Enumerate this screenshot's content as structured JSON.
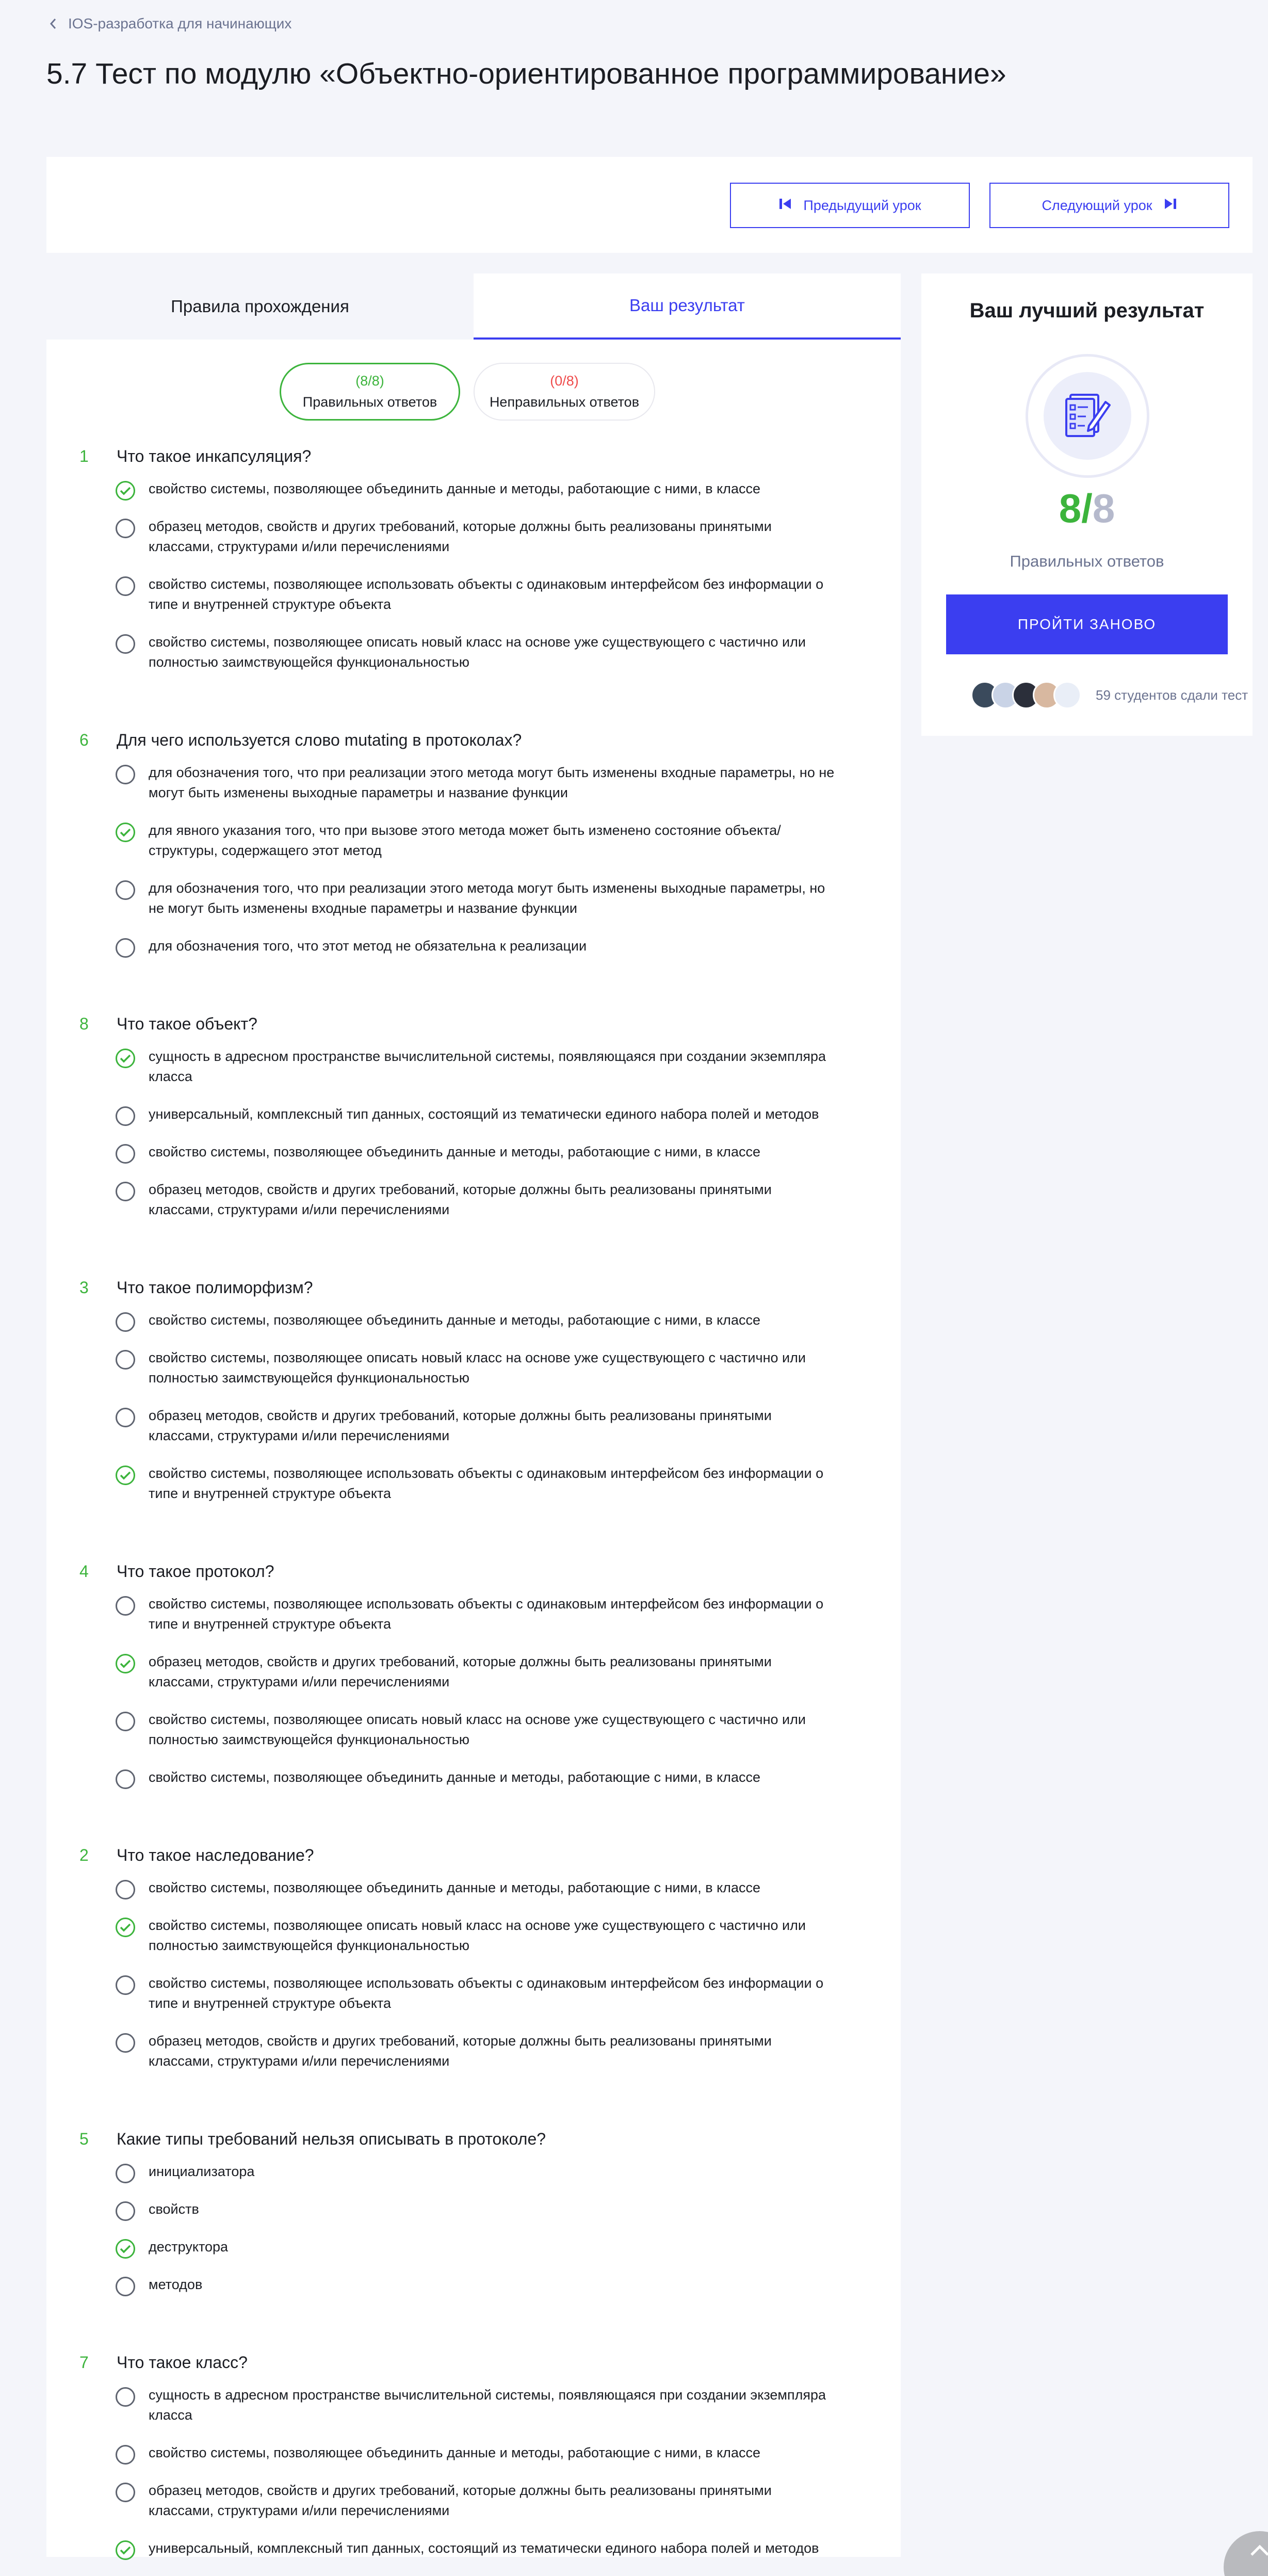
{
  "breadcrumb": {
    "label": "IOS-разработка для начинающих"
  },
  "page": {
    "title": "5.7 Тест по модулю «Объектно-ориентированное программирование»"
  },
  "nav": {
    "prev_label": "Предыдущий урок",
    "next_label": "Следующий урок"
  },
  "tabs": {
    "rules": "Правила прохождения",
    "result": "Ваш результат",
    "active": "result"
  },
  "summary": {
    "correct_count": "(8/8)",
    "correct_label": "Правильных ответов",
    "wrong_count": "(0/8)",
    "wrong_label": "Неправильных ответов"
  },
  "questions": [
    {
      "number": "1",
      "text": "Что такое инкапсуляция?",
      "options": [
        {
          "lines": [
            "свойство системы, позволяющее объединить данные и методы, работающие с ними, в классе"
          ],
          "selected": true
        },
        {
          "lines": [
            "образец методов, свойств и других требований, которые должны быть реализованы принятыми",
            "классами, структурами и/или перечислениями"
          ],
          "selected": false
        },
        {
          "lines": [
            "свойство системы, позволяющее использовать объекты с одинаковым интерфейсом без информации о",
            "типе и внутренней структуре объекта"
          ],
          "selected": false
        },
        {
          "lines": [
            "свойство системы, позволяющее описать новый класс на основе уже существующего с частично или",
            "полностью заимствующейся функциональностью"
          ],
          "selected": false
        }
      ]
    },
    {
      "number": "6",
      "text": "Для чего используется слово mutating в протоколах?",
      "options": [
        {
          "lines": [
            "для обозначения того, что при реализации этого метода могут быть изменены входные параметры, но не",
            "могут быть изменены выходные параметры и название функции"
          ],
          "selected": false
        },
        {
          "lines": [
            "для явного указания того, что при вызове этого метода может быть изменено состояние объекта/",
            "структуры, содержащего этот метод"
          ],
          "selected": true
        },
        {
          "lines": [
            "для обозначения того, что при реализации этого метода могут быть изменены выходные параметры, но",
            "не могут быть изменены входные параметры и название функции"
          ],
          "selected": false
        },
        {
          "lines": [
            "для обозначения того, что этот метод не обязательна к реализации"
          ],
          "selected": false
        }
      ]
    },
    {
      "number": "8",
      "text": "Что такое объект?",
      "options": [
        {
          "lines": [
            "сущность в адресном пространстве вычислительной системы, появляющаяся при создании экземпляра",
            "класса"
          ],
          "selected": true
        },
        {
          "lines": [
            "универсальный, комплексный тип данных, состоящий из тематически единого набора полей и методов"
          ],
          "selected": false
        },
        {
          "lines": [
            "свойство системы, позволяющее объединить данные и методы, работающие с ними, в классе"
          ],
          "selected": false
        },
        {
          "lines": [
            "образец методов, свойств и других требований, которые должны быть реализованы принятыми",
            "классами, структурами и/или перечислениями"
          ],
          "selected": false
        }
      ]
    },
    {
      "number": "3",
      "text": "Что такое полиморфизм?",
      "options": [
        {
          "lines": [
            "свойство системы, позволяющее объединить данные и методы, работающие с ними, в классе"
          ],
          "selected": false
        },
        {
          "lines": [
            "свойство системы, позволяющее описать новый класс на основе уже существующего с частично или",
            "полностью заимствующейся функциональностью"
          ],
          "selected": false
        },
        {
          "lines": [
            "образец методов, свойств и других требований, которые должны быть реализованы принятыми",
            "классами, структурами и/или перечислениями"
          ],
          "selected": false
        },
        {
          "lines": [
            "свойство системы, позволяющее использовать объекты с одинаковым интерфейсом без информации о",
            "типе и внутренней структуре объекта"
          ],
          "selected": true
        }
      ]
    },
    {
      "number": "4",
      "text": "Что такое протокол?",
      "options": [
        {
          "lines": [
            "свойство системы, позволяющее использовать объекты с одинаковым интерфейсом без информации о",
            "типе и внутренней структуре объекта"
          ],
          "selected": false
        },
        {
          "lines": [
            "образец методов, свойств и других требований, которые должны быть реализованы принятыми",
            "классами, структурами и/или перечислениями"
          ],
          "selected": true
        },
        {
          "lines": [
            "свойство системы, позволяющее описать новый класс на основе уже существующего с частично или",
            "полностью заимствующейся функциональностью"
          ],
          "selected": false
        },
        {
          "lines": [
            "свойство системы, позволяющее объединить данные и методы, работающие с ними, в классе"
          ],
          "selected": false
        }
      ]
    },
    {
      "number": "2",
      "text": "Что такое наследование?",
      "options": [
        {
          "lines": [
            "свойство системы, позволяющее объединить данные и методы, работающие с ними, в классе"
          ],
          "selected": false
        },
        {
          "lines": [
            "свойство системы, позволяющее описать новый класс на основе уже существующего с частично или",
            "полностью заимствующейся функциональностью"
          ],
          "selected": true
        },
        {
          "lines": [
            "свойство системы, позволяющее использовать объекты с одинаковым интерфейсом без информации о",
            "типе и внутренней структуре объекта"
          ],
          "selected": false
        },
        {
          "lines": [
            "образец методов, свойств и других требований, которые должны быть реализованы принятыми",
            "классами, структурами и/или перечислениями"
          ],
          "selected": false
        }
      ]
    },
    {
      "number": "5",
      "text": "Какие типы требований нельзя описывать в протоколе?",
      "options": [
        {
          "lines": [
            "инициализатора"
          ],
          "selected": false
        },
        {
          "lines": [
            "свойств"
          ],
          "selected": false
        },
        {
          "lines": [
            "деструктора"
          ],
          "selected": true
        },
        {
          "lines": [
            "методов"
          ],
          "selected": false
        }
      ]
    },
    {
      "number": "7",
      "text": "Что такое класс?",
      "options": [
        {
          "lines": [
            "сущность в адресном пространстве вычислительной системы, появляющаяся при создании экземпляра",
            "класса"
          ],
          "selected": false
        },
        {
          "lines": [
            "свойство системы, позволяющее объединить данные и методы, работающие с ними, в классе"
          ],
          "selected": false
        },
        {
          "lines": [
            "образец методов, свойств и других требований, которые должны быть реализованы принятыми",
            "классами, структурами и/или перечислениями"
          ],
          "selected": false
        },
        {
          "lines": [
            "универсальный, комплексный тип данных, состоящий из тематически единого набора полей и методов"
          ],
          "selected": true
        }
      ]
    }
  ],
  "best_result": {
    "title": "Ваш лучший результат",
    "score_correct": "8",
    "score_separator": "/",
    "score_total": "8",
    "label": "Правильных ответов",
    "retry_label": "ПРОЙТИ ЗАНОВО",
    "students_text": "59 студентов сдали тест",
    "avatar_colors": [
      "#3a4a5c",
      "#c9d3e6",
      "#2b2f3a",
      "#d8b8a0",
      "#e9eef7"
    ]
  },
  "colors": {
    "accent": "#3b3ef0",
    "success": "#3cb43c",
    "danger": "#ef4b4b",
    "muted": "#6b7390"
  },
  "icons": {
    "breadcrumb": "chevron-left-icon",
    "prev": "skip-back-icon",
    "next": "skip-forward-icon",
    "badge": "test-document-icon",
    "selected": "check-circle-icon",
    "scroll": "chevron-up-icon"
  }
}
